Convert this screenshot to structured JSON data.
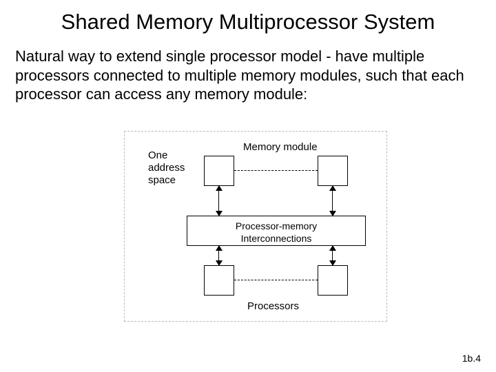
{
  "title": "Shared Memory Multiprocessor System",
  "body": "Natural way to extend single processor model - have multiple processors connected to multiple memory modules, such that each processor can access any memory module:",
  "diagram": {
    "memory_module_label": "Memory module",
    "one_address_space_label": "One address space",
    "interconnect_line1": "Processor-memory",
    "interconnect_line2": "Interconnections",
    "processors_label": "Processors"
  },
  "page_number": "1b.4"
}
